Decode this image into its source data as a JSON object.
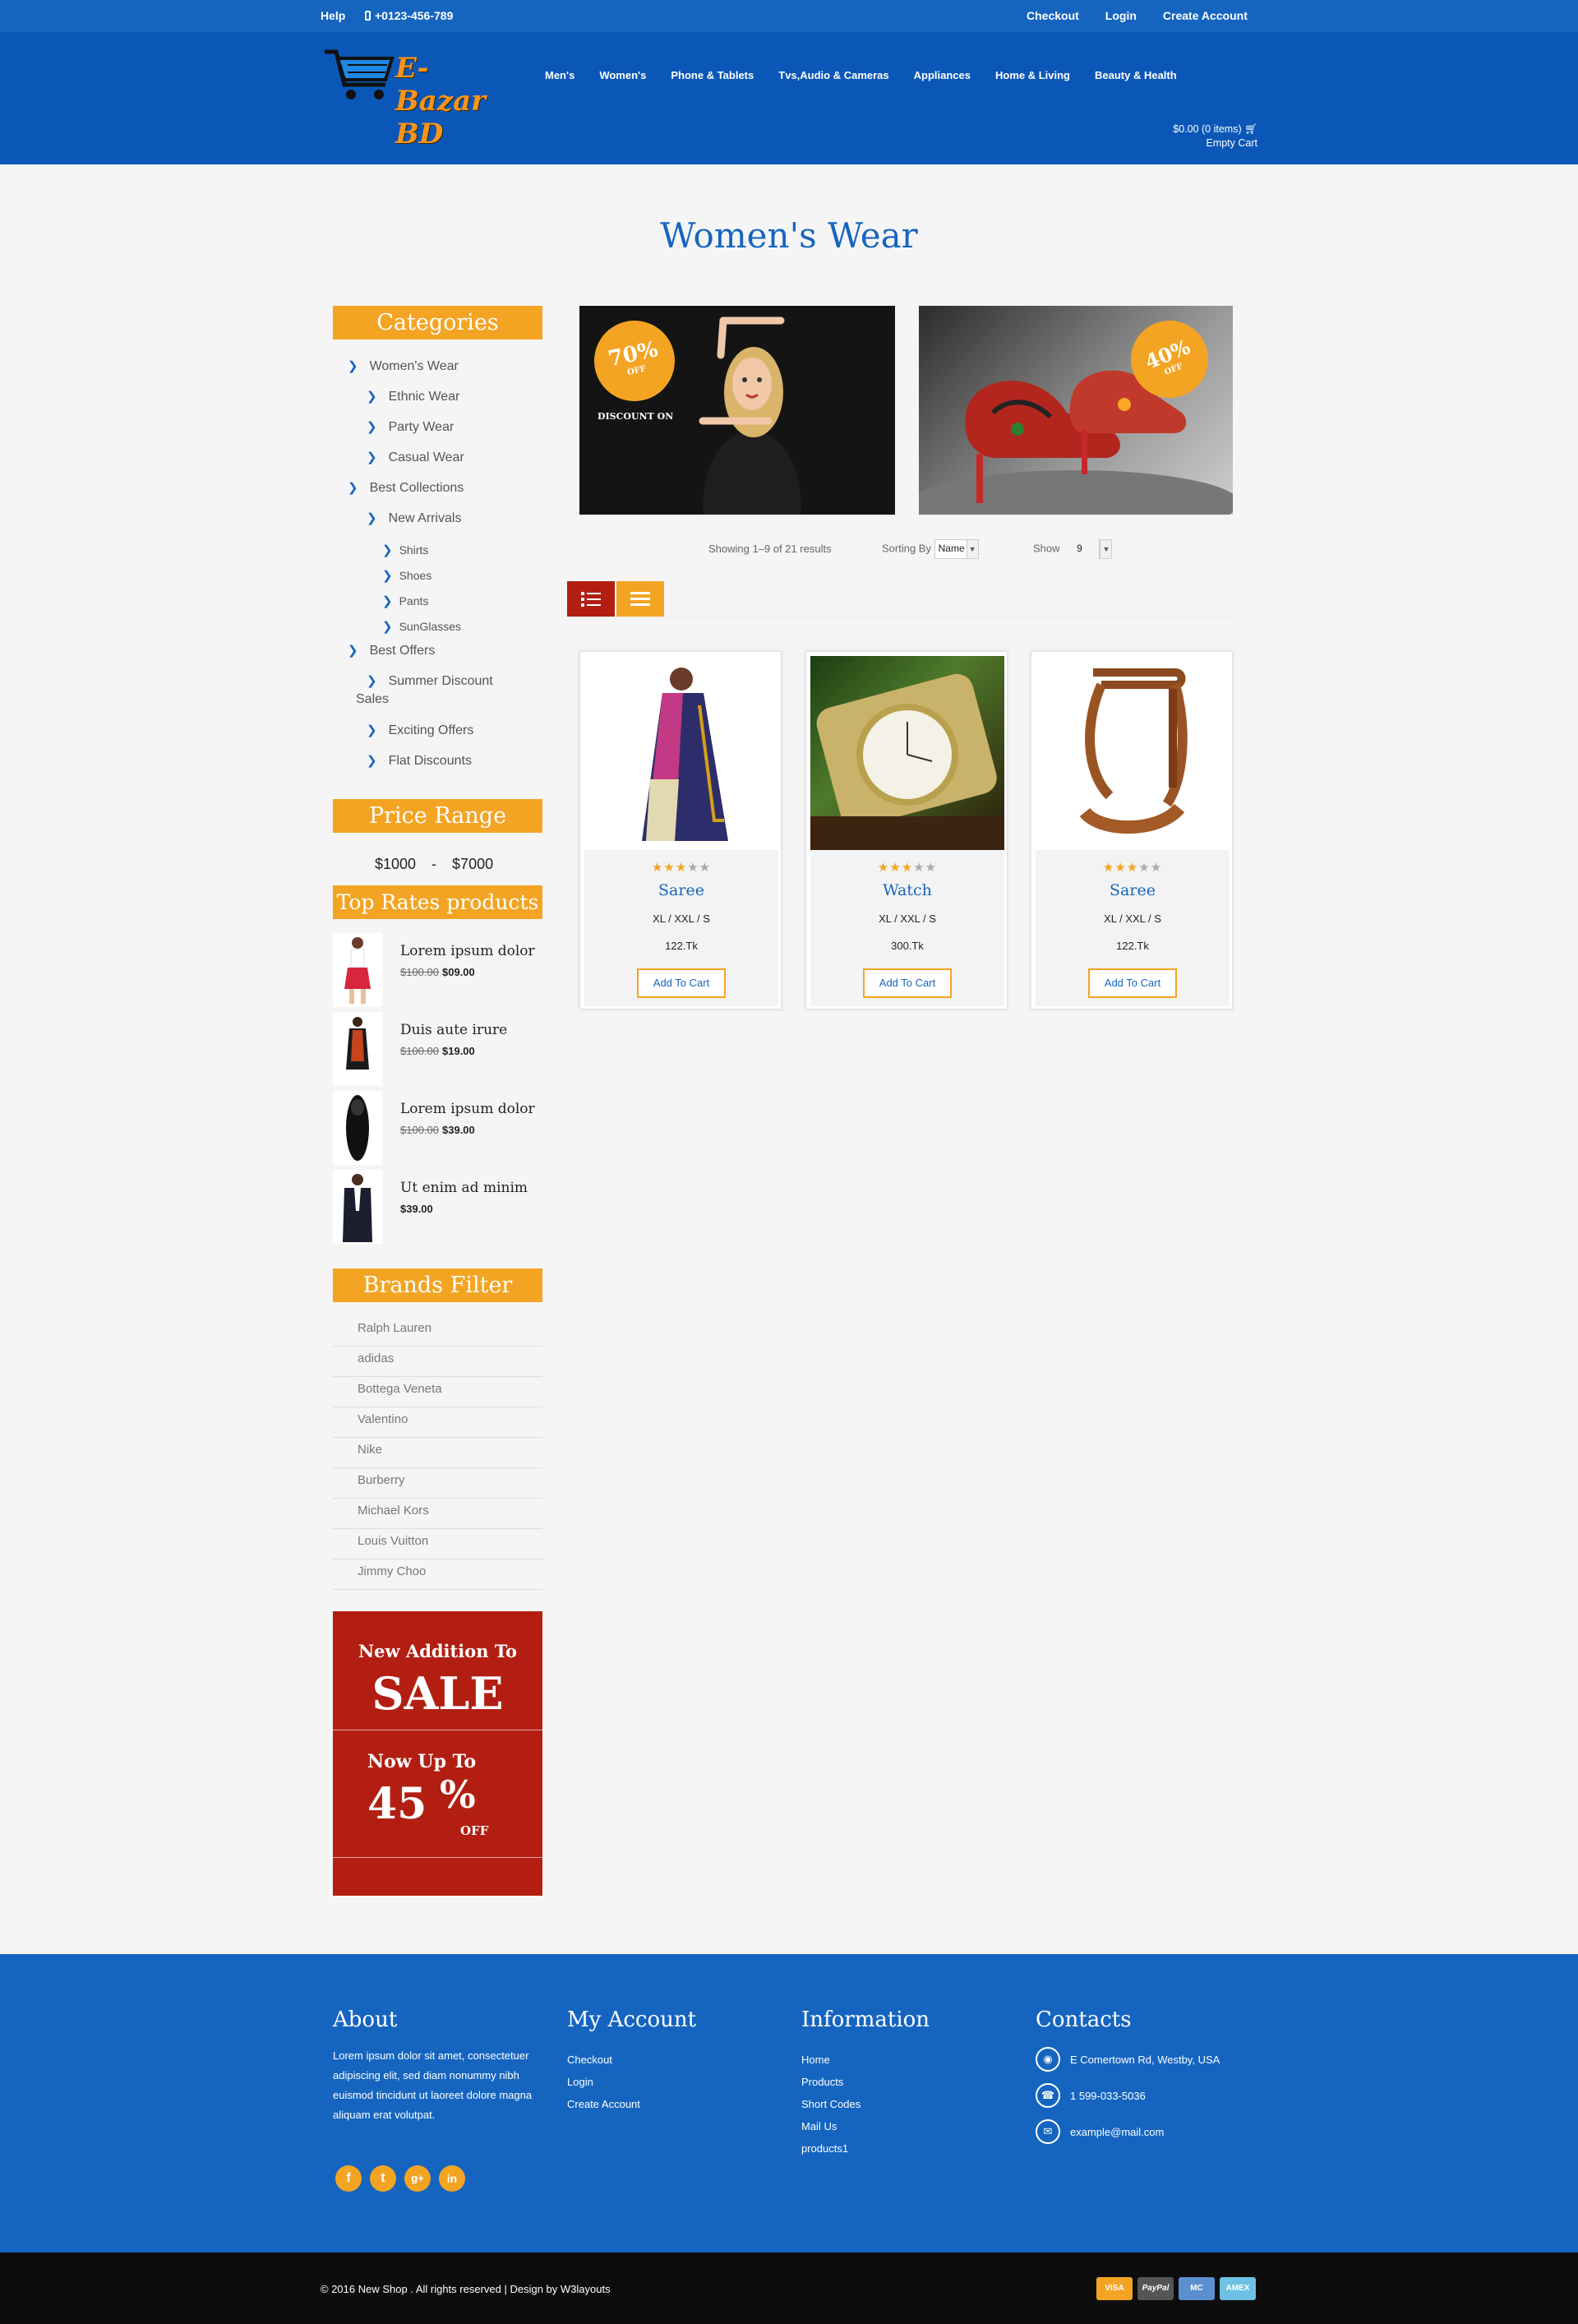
{
  "topbar": {
    "help": "Help",
    "phone": "+0123-456-789",
    "links": [
      "Checkout",
      "Login",
      "Create Account"
    ]
  },
  "header": {
    "logo_text": "E-Bazar BD",
    "nav": [
      "Men's",
      "Women's",
      "Phone & Tablets",
      "Tvs,Audio & Cameras",
      "Appliances",
      "Home & Living",
      "Beauty & Health"
    ],
    "cart_total": "$0.00 (0 items)",
    "cart_empty": "Empty Cart"
  },
  "page_title": "Women's Wear",
  "sidebar": {
    "categories_title": "Categories",
    "categories": [
      {
        "label": "Women's Wear",
        "level": 1
      },
      {
        "label": "Ethnic Wear",
        "level": 2
      },
      {
        "label": "Party Wear",
        "level": 2
      },
      {
        "label": "Casual Wear",
        "level": 2
      },
      {
        "label": "Best Collections",
        "level": 1
      },
      {
        "label": "New Arrivals",
        "level": 2
      },
      {
        "label": "Shirts",
        "level": 3
      },
      {
        "label": "Shoes",
        "level": 3
      },
      {
        "label": "Pants",
        "level": 3
      },
      {
        "label": "SunGlasses",
        "level": 3
      },
      {
        "label": "Best Offers",
        "level": 1
      },
      {
        "label": "Summer Discount",
        "level": 2
      },
      {
        "label": "Sales",
        "level": 2
      },
      {
        "label": "Exciting Offers",
        "level": 2
      },
      {
        "label": "Flat Discounts",
        "level": 2
      }
    ],
    "price_range_title": "Price Range",
    "price_range": "$1000 - $7000",
    "top_rated_title": "Top Rates products",
    "top_rated": [
      {
        "title": "Lorem ipsum dolor",
        "old_price": "$100.00",
        "price": "$09.00"
      },
      {
        "title": "Duis aute irure",
        "old_price": "$100.00",
        "price": "$19.00"
      },
      {
        "title": "Lorem ipsum dolor",
        "old_price": "$100.00",
        "price": "$39.00"
      },
      {
        "title": "Ut enim ad minim",
        "old_price": "",
        "price": "$39.00"
      }
    ],
    "brands_title": "Brands Filter",
    "brands": [
      "Ralph Lauren",
      "adidas",
      "Bottega Veneta",
      "Valentino",
      "Nike",
      "Burberry",
      "Michael Kors",
      "Louis Vuitton",
      "Jimmy Choo"
    ],
    "sale_banner": {
      "line1": "New Addition To",
      "line2": "SALE",
      "line3": "Now Up To",
      "line4": "45",
      "line5": "%",
      "line6": "OFF"
    }
  },
  "banners": [
    {
      "badge_pct": "70%",
      "badge_off": "OFF",
      "caption": "DISCOUNT ON"
    },
    {
      "badge_pct": "40%",
      "badge_off": "OFF"
    }
  ],
  "results": {
    "showing": "Showing 1–9 of 21 results",
    "sort_label": "Sorting By",
    "sort_value": "Name",
    "show_label": "Show",
    "show_value": "9"
  },
  "products": [
    {
      "name": "Saree",
      "sizes": "XL / XXL / S",
      "price": "122.Tk",
      "rating": 3,
      "button": "Add To Cart"
    },
    {
      "name": "Watch",
      "sizes": "XL / XXL / S",
      "price": "300.Tk",
      "rating": 3,
      "button": "Add To Cart"
    },
    {
      "name": "Saree",
      "sizes": "XL / XXL / S",
      "price": "122.Tk",
      "rating": 3,
      "button": "Add To Cart"
    }
  ],
  "footer": {
    "about_title": "About",
    "about_text": "Lorem ipsum dolor sit amet, consectetuer adipiscing elit, sed diam nonummy nibh euismod tincidunt ut laoreet dolore magna aliquam erat volutpat.",
    "account_title": "My Account",
    "account_links": [
      "Checkout",
      "Login",
      "Create Account"
    ],
    "info_title": "Information",
    "info_links": [
      "Home",
      "Products",
      "Short Codes",
      "Mail Us",
      "products1"
    ],
    "contacts_title": "Contacts",
    "address": "E Comertown Rd, Westby, USA",
    "phone": "1 599-033-5036",
    "email": "example@mail.com",
    "social": [
      "f",
      "t",
      "g+",
      "in"
    ]
  },
  "bottom": {
    "copyright": "© 2016 New Shop . All rights reserved | Design by  W3layouts",
    "payments": [
      "VISA",
      "PayPal",
      "MC",
      "AMEX"
    ]
  },
  "colors": {
    "blue": "#1565c0",
    "orange": "#f4a423",
    "red": "#b21f12"
  }
}
